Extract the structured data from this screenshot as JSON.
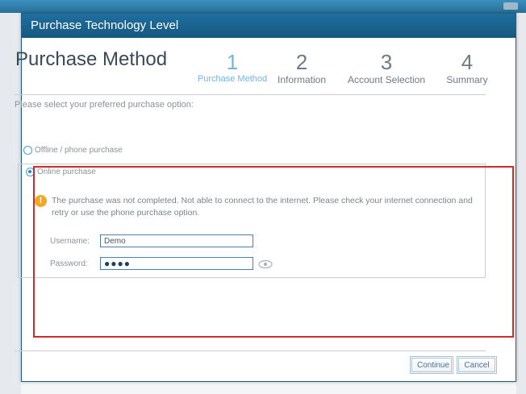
{
  "window": {
    "title": "Purchase Technology Level"
  },
  "header": {
    "title": "Purchase Method"
  },
  "steps": [
    {
      "number": "1",
      "label": "Purchase Method",
      "active": true
    },
    {
      "number": "2",
      "label": "Information",
      "active": false
    },
    {
      "number": "3",
      "label": "Account Selection",
      "active": false
    },
    {
      "number": "4",
      "label": "Summary",
      "active": false
    }
  ],
  "form": {
    "prompt": "Please select your preferred purchase option:",
    "options": [
      {
        "label": "Offline / phone purchase",
        "selected": false
      },
      {
        "label": "Online purchase",
        "selected": true
      }
    ],
    "warning": "The purchase was not completed.  Not able to connect to the internet.  Please check your internet connection and retry or use the phone purchase option.",
    "username": {
      "label": "Username:",
      "value": "Demo"
    },
    "password": {
      "label": "Password:",
      "value": "●●●●"
    }
  },
  "footer": {
    "continue_label": "Continue",
    "cancel_label": "Cancel"
  },
  "colors": {
    "titlebar": "#1a6490",
    "accent": "#6fb6e0",
    "highlight": "#d02a2a",
    "warning": "#f0a820"
  },
  "icons": {
    "warning": "warning-icon",
    "eye": "eye-icon"
  }
}
